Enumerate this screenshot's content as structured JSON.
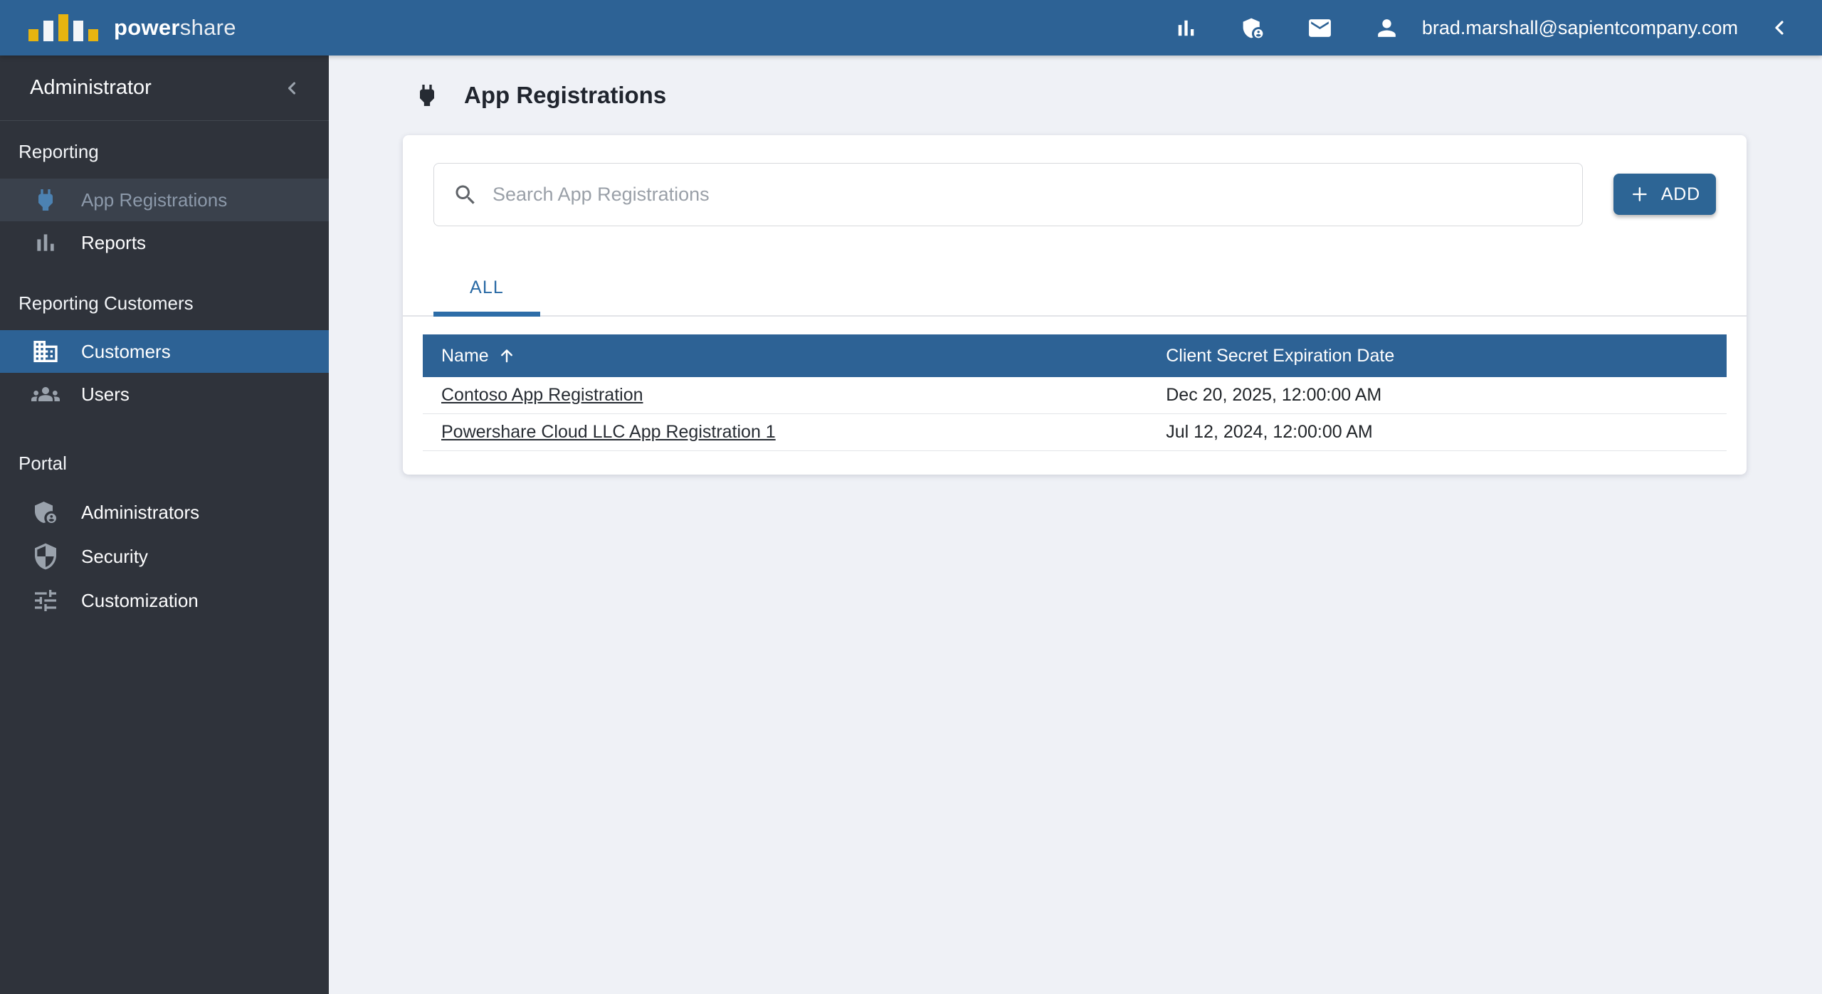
{
  "colors": {
    "accent_blue": "#2d6295",
    "brand_yellow": "#e7b410",
    "sidebar_bg": "#2f333b",
    "page_bg": "#eff1f6",
    "table_header_bg": "#2d6295"
  },
  "topbar": {
    "brand_bold": "power",
    "brand_light": "share",
    "icons": [
      "bar-chart",
      "admin-shield",
      "mail",
      "account"
    ],
    "user_email": "brad.marshall@sapientcompany.com"
  },
  "sidebar": {
    "role_title": "Administrator",
    "sections": [
      {
        "label": "Reporting",
        "items": [
          {
            "label": "App Registrations",
            "icon": "power-plug",
            "state": "active-muted"
          },
          {
            "label": "Reports",
            "icon": "bar-chart",
            "state": "normal"
          }
        ]
      },
      {
        "label": "Reporting Customers",
        "items": [
          {
            "label": "Customers",
            "icon": "building",
            "state": "selected"
          },
          {
            "label": "Users",
            "icon": "people-group",
            "state": "normal"
          }
        ]
      },
      {
        "label": "Portal",
        "items": [
          {
            "label": "Administrators",
            "icon": "admin-shield",
            "state": "normal"
          },
          {
            "label": "Security",
            "icon": "security-shield",
            "state": "normal"
          },
          {
            "label": "Customization",
            "icon": "tune-sliders",
            "state": "normal"
          }
        ]
      }
    ]
  },
  "main": {
    "page_title": "App Registrations",
    "title_icon": "power-plug",
    "search": {
      "placeholder": "Search App Registrations",
      "value": ""
    },
    "add_button_label": "ADD",
    "tabs": [
      {
        "label": "ALL",
        "active": true
      }
    ],
    "table": {
      "columns": [
        {
          "label": "Name",
          "sorted": "ascending"
        },
        {
          "label": "Client Secret Expiration Date",
          "sorted": "none"
        }
      ],
      "rows": [
        {
          "name": "Contoso App Registration",
          "expiration": "Dec 20, 2025, 12:00:00 AM"
        },
        {
          "name": "Powershare Cloud LLC App Registration 1",
          "expiration": "Jul 12, 2024, 12:00:00 AM"
        }
      ]
    }
  }
}
